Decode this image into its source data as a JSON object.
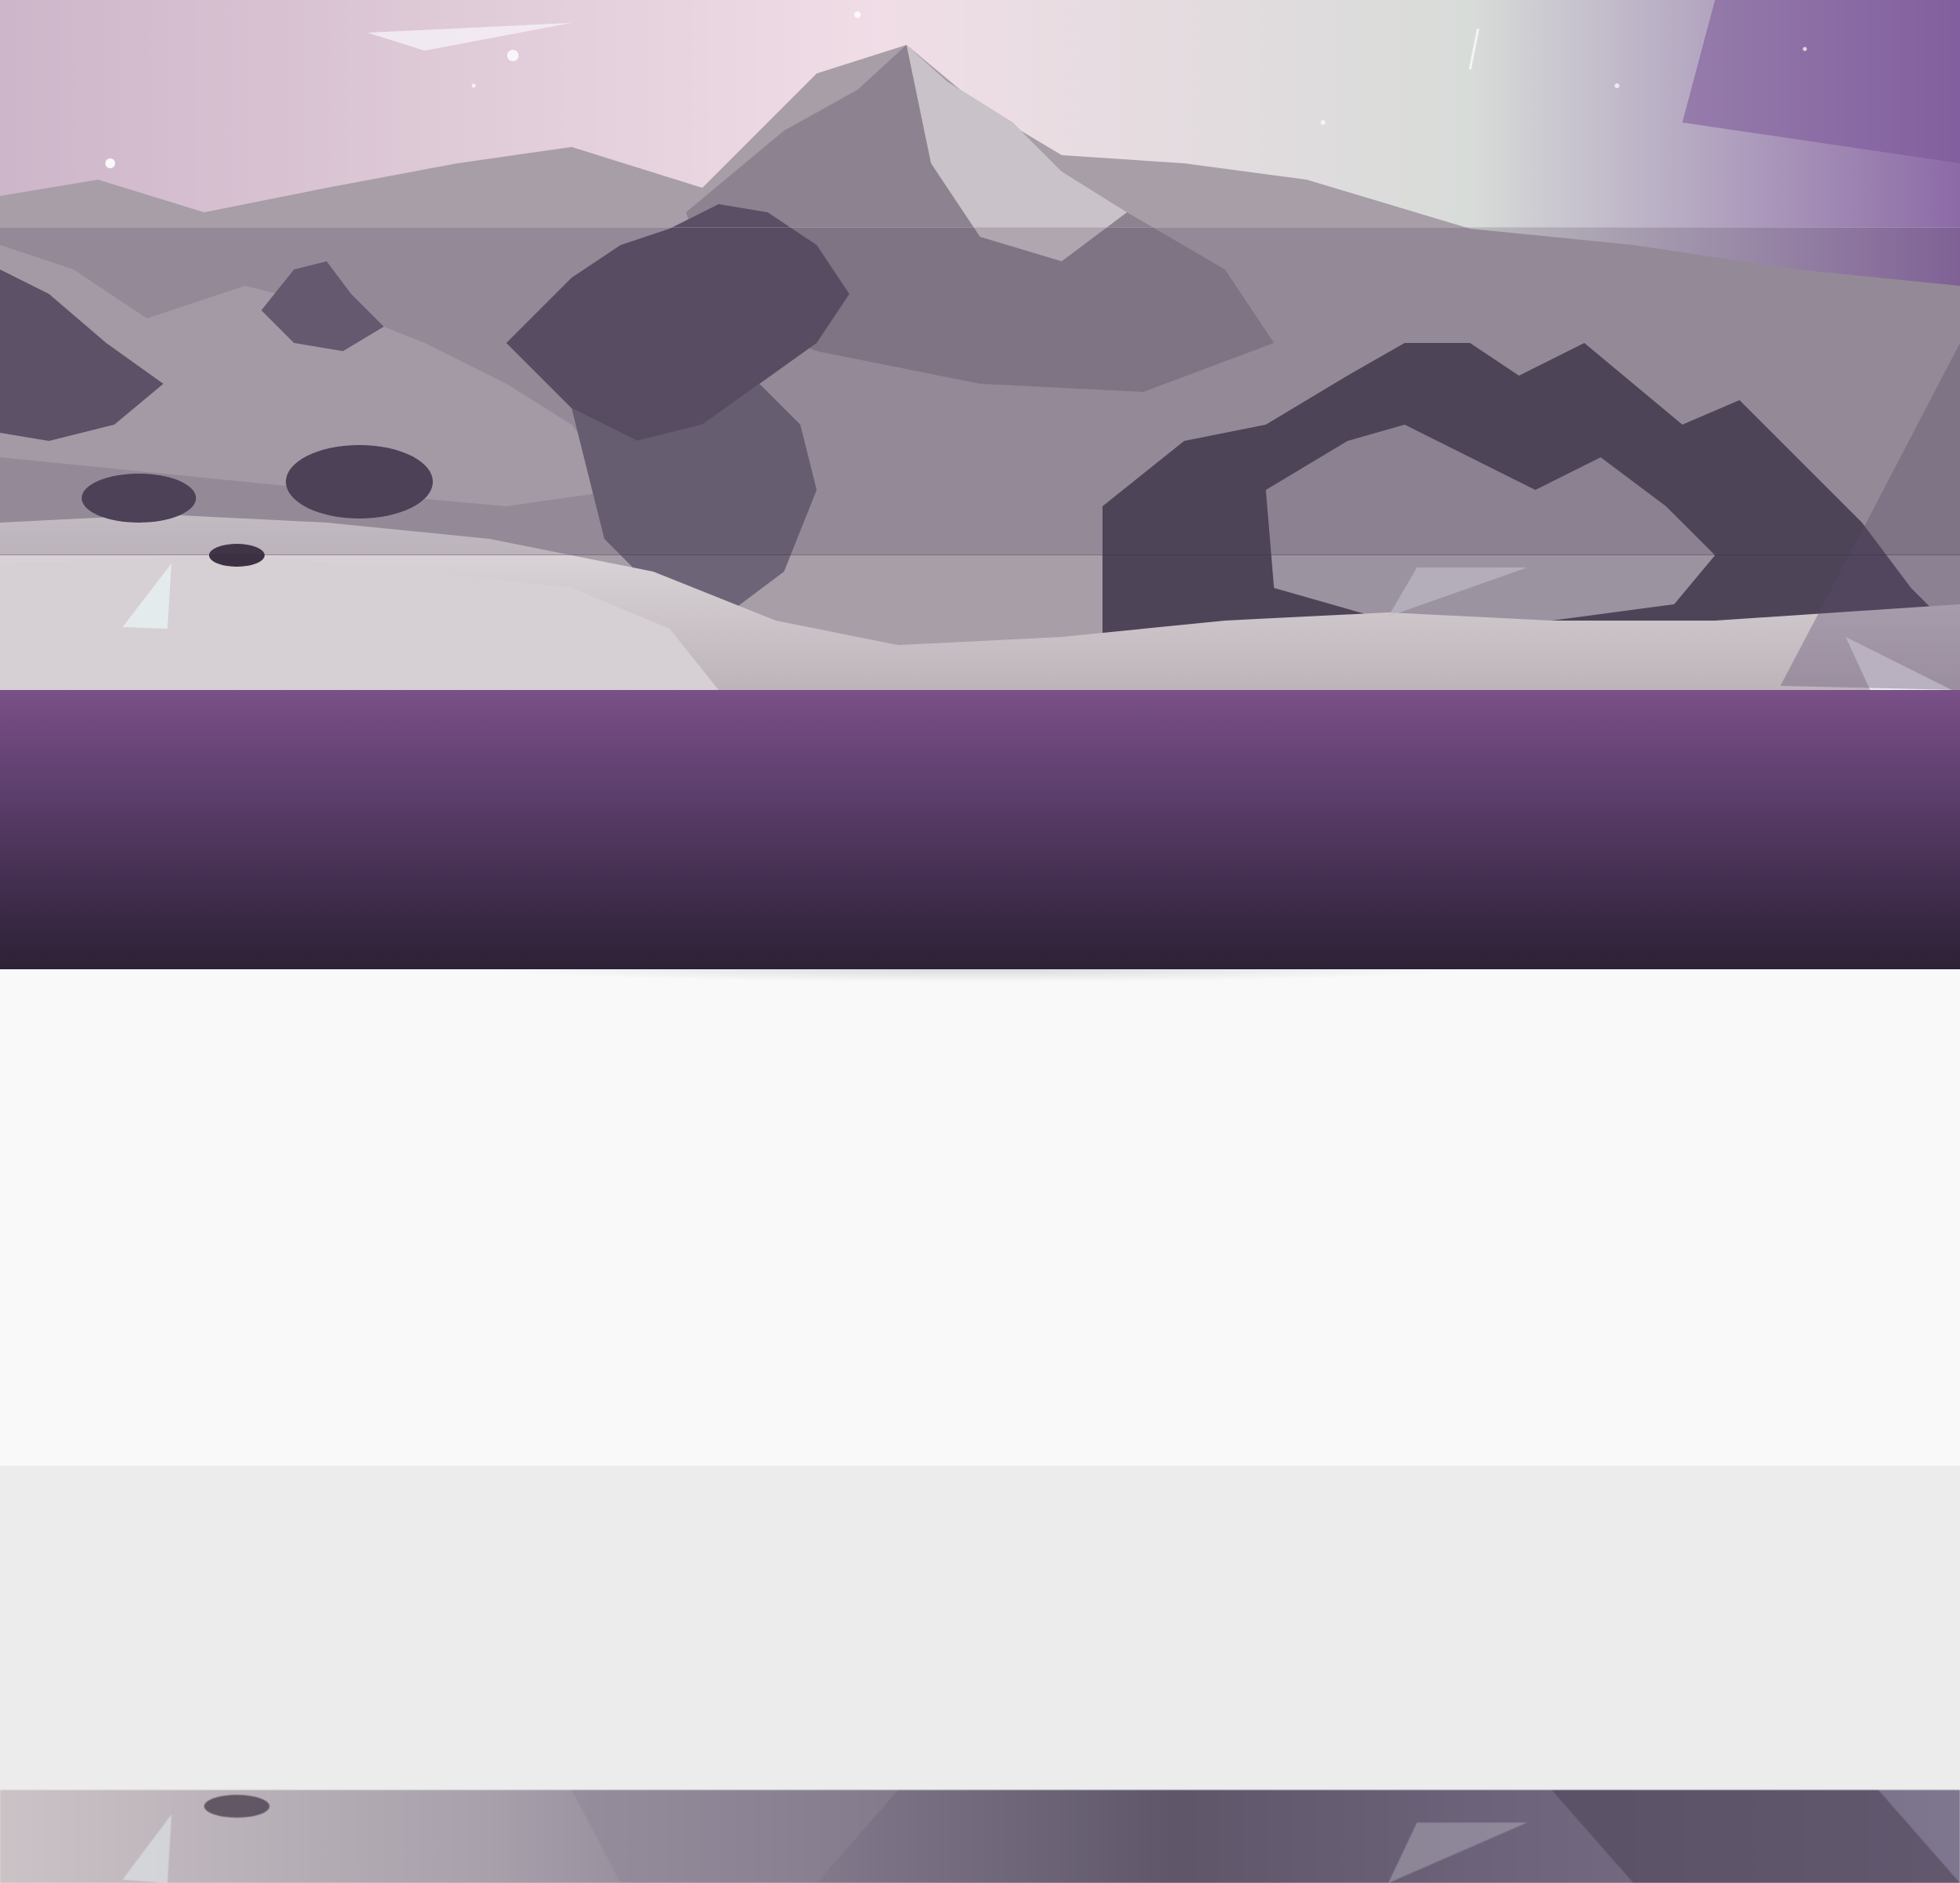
{
  "hero": {
    "scene": "mountain-landscape",
    "accent_color": "#7a5088"
  },
  "header": {
    "gradient_top": "#7a5088",
    "gradient_bottom": "#2d2235"
  },
  "content": {
    "background": "#f9f9f9"
  },
  "secondary": {
    "background": "#ececec"
  }
}
